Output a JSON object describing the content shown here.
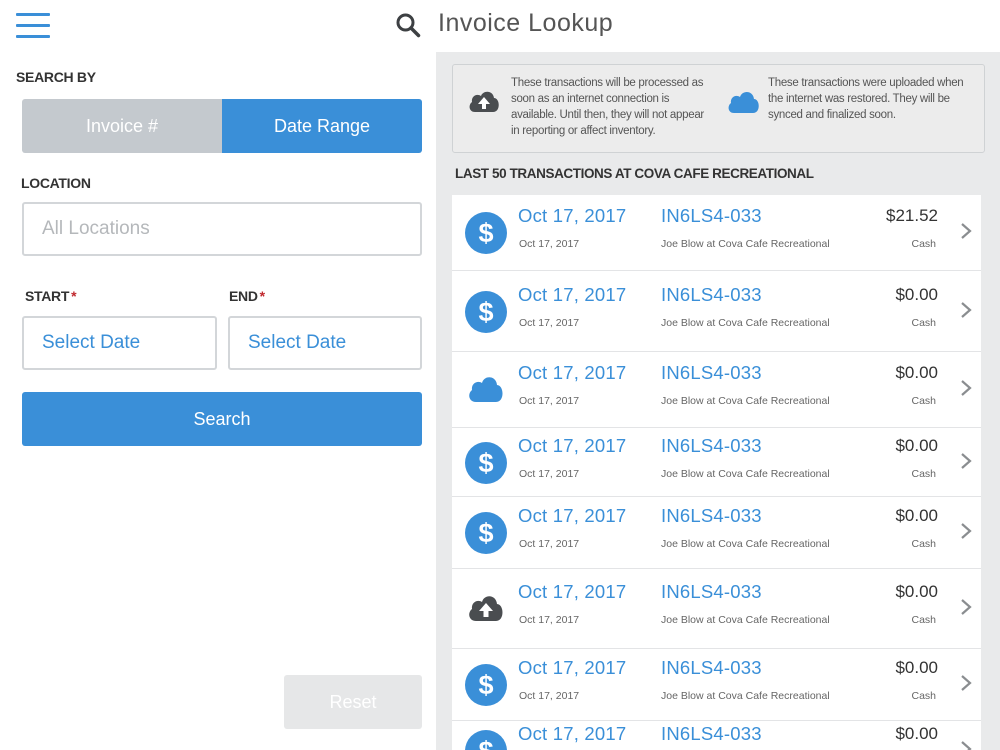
{
  "header": {
    "title": "Invoice Lookup",
    "menu_icon": "hamburger-menu-icon",
    "search_icon": "search-icon"
  },
  "search_panel": {
    "search_by_label": "SEARCH BY",
    "tabs": [
      {
        "label": "Invoice #",
        "active": false
      },
      {
        "label": "Date Range",
        "active": true
      }
    ],
    "location_label": "LOCATION",
    "location_placeholder": "All Locations",
    "start_label": "START",
    "end_label": "END",
    "required_marker": "*",
    "start_placeholder": "Select Date",
    "end_placeholder": "Select Date",
    "search_button": "Search",
    "reset_button": "Reset"
  },
  "info_banner": {
    "pending_text": "These transactions will be processed as soon as an internet connection is available. Until then, they will not appear in reporting or affect inventory.",
    "uploaded_text": "These transactions were uploaded when the internet was restored. They will be synced and finalized soon.",
    "pending_icon": "cloud-upload-icon",
    "uploaded_icon": "cloud-icon"
  },
  "transactions_title": "LAST 50 TRANSACTIONS AT COVA CAFE RECREATIONAL",
  "transactions": [
    {
      "icon": "dollar",
      "date": "Oct 17, 2017",
      "date_small": "Oct 17, 2017",
      "invoice": "IN6LS4-033",
      "desc": "Joe Blow at Cova Cafe Recreational",
      "amount": "$21.52",
      "payment": "Cash"
    },
    {
      "icon": "dollar",
      "date": "Oct 17, 2017",
      "date_small": "Oct 17, 2017",
      "invoice": "IN6LS4-033",
      "desc": "Joe Blow at Cova Cafe Recreational",
      "amount": "$0.00",
      "payment": "Cash"
    },
    {
      "icon": "cloud",
      "date": "Oct 17, 2017",
      "date_small": "Oct 17, 2017",
      "invoice": "IN6LS4-033",
      "desc": "Joe Blow at Cova Cafe Recreational",
      "amount": "$0.00",
      "payment": "Cash"
    },
    {
      "icon": "dollar",
      "date": "Oct 17, 2017",
      "date_small": "Oct 17, 2017",
      "invoice": "IN6LS4-033",
      "desc": "Joe Blow at Cova Cafe Recreational",
      "amount": "$0.00",
      "payment": "Cash"
    },
    {
      "icon": "dollar",
      "date": "Oct 17, 2017",
      "date_small": "Oct 17, 2017",
      "invoice": "IN6LS4-033",
      "desc": "Joe Blow at Cova Cafe Recreational",
      "amount": "$0.00",
      "payment": "Cash"
    },
    {
      "icon": "cloud-upload",
      "date": "Oct 17, 2017",
      "date_small": "Oct 17, 2017",
      "invoice": "IN6LS4-033",
      "desc": "Joe Blow at Cova Cafe Recreational",
      "amount": "$0.00",
      "payment": "Cash"
    },
    {
      "icon": "dollar",
      "date": "Oct 17, 2017",
      "date_small": "Oct 17, 2017",
      "invoice": "IN6LS4-033",
      "desc": "Joe Blow at Cova Cafe Recreational",
      "amount": "$0.00",
      "payment": "Cash"
    },
    {
      "icon": "dollar",
      "date": "Oct 17, 2017",
      "date_small": "",
      "invoice": "IN6LS4-033",
      "desc": "",
      "amount": "$0.00",
      "payment": ""
    }
  ],
  "colors": {
    "accent": "#3a8fd8",
    "inactive_tab": "#c4c9ce",
    "required": "#c0282d",
    "panel_bg": "#e9eaeb",
    "icon_gray": "#4a4d50"
  }
}
